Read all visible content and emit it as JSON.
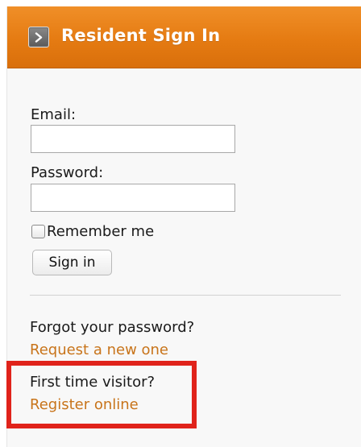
{
  "header": {
    "title": "Resident Sign In",
    "icon": "chevron-right-icon",
    "color": "#e57b12"
  },
  "form": {
    "email_label": "Email:",
    "email_value": "",
    "password_label": "Password:",
    "password_value": "",
    "remember_label": "Remember me",
    "remember_checked": false,
    "signin_label": "Sign in"
  },
  "help": {
    "forgot_text": "Forgot your password?",
    "forgot_link": "Request a new one",
    "first_time_text": "First time visitor?",
    "register_link": "Register online",
    "link_color": "#c8741a",
    "highlight_color": "#e0231b"
  }
}
